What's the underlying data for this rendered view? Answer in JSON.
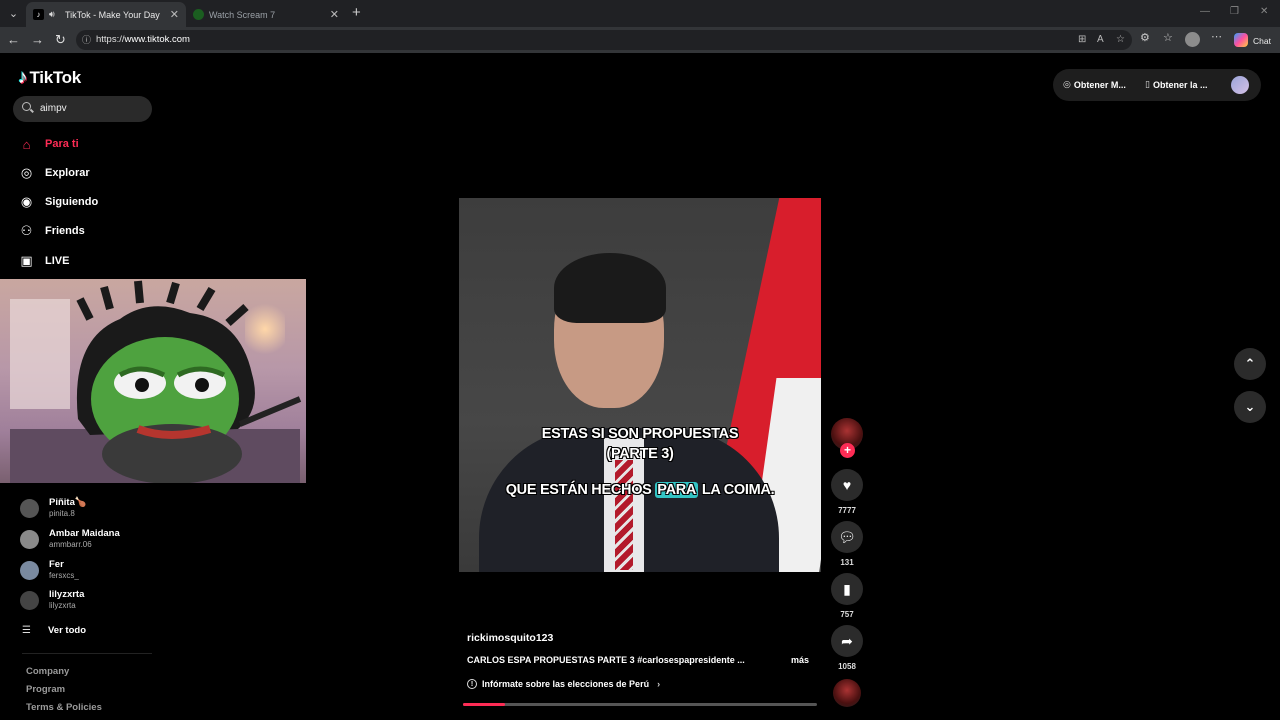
{
  "browser": {
    "tabs": [
      {
        "title": "TikTok - Make Your Day",
        "active": true
      },
      {
        "title": "Watch Scream 7",
        "active": false
      }
    ],
    "address": {
      "scheme": "https://",
      "host": "www.tiktok.com"
    },
    "chat_label": "Chat"
  },
  "sidebar": {
    "logo_text": "TikTok",
    "search_value": "aimpv",
    "nav": [
      {
        "label": "Para ti",
        "icon": "home-icon",
        "active": true
      },
      {
        "label": "Explorar",
        "icon": "compass-icon",
        "active": false
      },
      {
        "label": "Siguiendo",
        "icon": "following-icon",
        "active": false
      },
      {
        "label": "Friends",
        "icon": "friends-icon",
        "active": false
      },
      {
        "label": "LIVE",
        "icon": "live-icon",
        "active": false
      }
    ],
    "following": [
      {
        "name": "Piñita🍗",
        "handle": "pinita.8"
      },
      {
        "name": "Ambar Maidana",
        "handle": "ammbarr.06"
      },
      {
        "name": "Fer",
        "handle": "fersxcs_"
      },
      {
        "name": "lilyzxrta",
        "handle": "lilyzxrta"
      }
    ],
    "see_all": "Ver todo",
    "footer": [
      "Company",
      "Program",
      "Terms & Policies"
    ]
  },
  "top_right": {
    "item1": "Obtener M...",
    "item2": "Obtener la ..."
  },
  "video": {
    "caption_line1": "ESTAS SI SON PROPUESTAS",
    "caption_line2": "(PARTE 3)",
    "caption_pre": "QUE ESTÁN HECHOS",
    "caption_highlight": "PARA",
    "caption_post": "LA COIMA.",
    "author": "rickimosquito123",
    "description": "CARLOS ESPA PROPUESTAS PARTE 3 #carlosespapresidente ...",
    "more": "más",
    "election_banner": "Infórmate sobre las elecciones de Perú",
    "progress": 0.12
  },
  "actions": {
    "likes": "7777",
    "comments": "131",
    "saves": "757",
    "shares": "1058"
  },
  "colors": {
    "accent": "#fe2c55",
    "highlight": "#33c4c4"
  }
}
